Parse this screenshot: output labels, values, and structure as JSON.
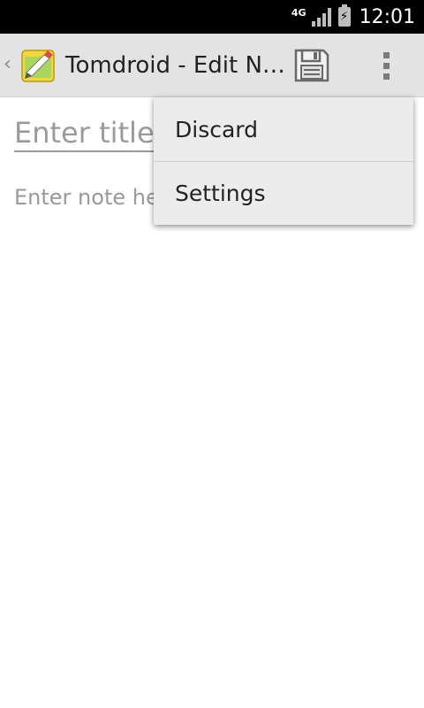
{
  "status_bar": {
    "network": "4G",
    "time": "12:01",
    "icons": [
      "signal-icon",
      "battery-charging-icon"
    ]
  },
  "action_bar": {
    "title": "Tomdroid - Edit N…",
    "icons": [
      "up-caret-icon",
      "app-icon",
      "save-icon",
      "overflow-menu-icon"
    ]
  },
  "editor": {
    "title_placeholder": "Enter title",
    "note_placeholder": "Enter note he"
  },
  "overflow_menu": {
    "items": [
      {
        "label": "Discard"
      },
      {
        "label": "Settings"
      }
    ]
  },
  "colors": {
    "status_bar_bg": "#000000",
    "action_bar_bg": "#e3e3e3",
    "menu_bg": "#ececec",
    "placeholder_text": "#9a9a9a"
  }
}
